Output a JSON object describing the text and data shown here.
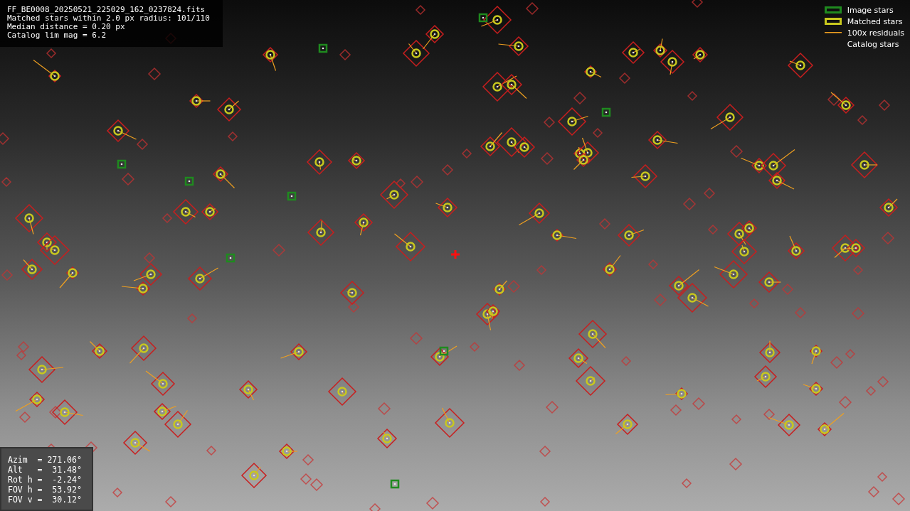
{
  "info_panel": {
    "lines": [
      "FF_BE0008_20250521_225029_162_0237824.fits",
      "Matched stars within 2.0 px radius: 101/110",
      "Median distance = 0.20 px",
      "Catalog lim mag = 6.2"
    ]
  },
  "legend": [
    {
      "kind": "image",
      "label": "Image stars"
    },
    {
      "kind": "matched",
      "label": "Matched stars"
    },
    {
      "kind": "residual",
      "label": "100x residuals"
    },
    {
      "kind": "catalog",
      "label": "Catalog stars"
    }
  ],
  "pointing_panel": {
    "lines": [
      "Azim  = 271.06°",
      "Alt   =  31.48°",
      "Rot h =  -2.24°",
      "FOV h =  53.92°",
      "FOV v =  30.12°"
    ]
  }
}
